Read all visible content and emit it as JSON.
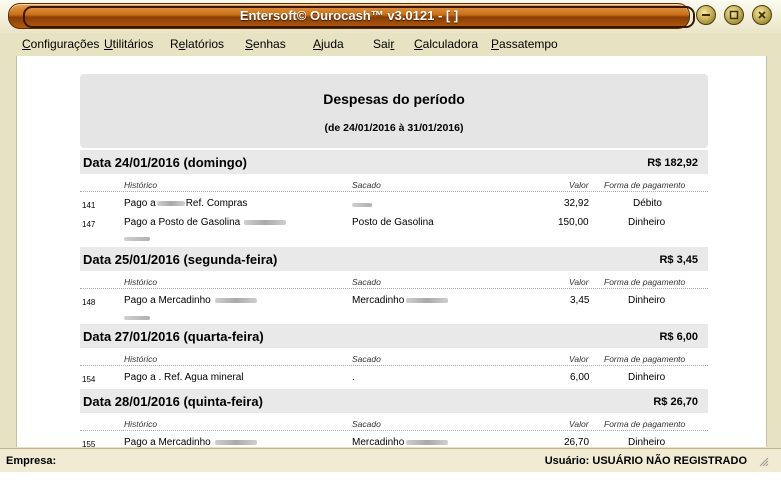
{
  "window": {
    "title": "Entersoft© Ourocash™ v3.0121 - [ ]"
  },
  "menu": [
    {
      "label": "Configurações",
      "underline_index": 0
    },
    {
      "label": "Utilitários",
      "underline_index": 0
    },
    {
      "label": "Relatórios",
      "underline_index": 1
    },
    {
      "label": "Senhas",
      "underline_index": 0
    },
    {
      "label": "Ajuda",
      "underline_index": 0
    },
    {
      "label": "Sair",
      "underline_index": 3
    },
    {
      "label": "Calculadora",
      "underline_index": 0
    },
    {
      "label": "Passatempo",
      "underline_index": 0
    }
  ],
  "report": {
    "title": "Despesas do período",
    "subtitle": "(de 24/01/2016 à 31/01/2016)",
    "col_historico": "Histórico",
    "col_sacado": "Sacado",
    "col_valor": "Valor",
    "col_forma": "Forma de pagamento",
    "days": [
      {
        "label": "Data 24/01/2016  (domingo)",
        "total": "R$ 182,92",
        "rows": [
          {
            "id": "141",
            "historico_prefix": "Pago a",
            "historico_suffix": "Ref. Compras",
            "sacado": "",
            "valor": "32,92",
            "forma": "Débito"
          },
          {
            "id": "147",
            "historico_prefix": "Pago a Posto de Gasolina",
            "historico_suffix": "",
            "sacado": "Posto de Gasolina",
            "valor": "150,00",
            "forma": "Dinheiro"
          }
        ]
      },
      {
        "label": "Data 25/01/2016  (segunda-feira)",
        "total": "R$ 3,45",
        "rows": [
          {
            "id": "148",
            "historico_prefix": "Pago a Mercadinho",
            "historico_suffix": "",
            "sacado": "Mercadinho",
            "valor": "3,45",
            "forma": "Dinheiro"
          }
        ]
      },
      {
        "label": "Data 27/01/2016  (quarta-feira)",
        "total": "R$ 6,00",
        "rows": [
          {
            "id": "154",
            "historico_prefix": "Pago a . Ref. Agua mineral",
            "historico_suffix": "",
            "sacado": ".",
            "valor": "6,00",
            "forma": "Dinheiro"
          }
        ]
      },
      {
        "label": "Data 28/01/2016  (quinta-feira)",
        "total": "R$ 26,70",
        "rows": [
          {
            "id": "155",
            "historico_prefix": "Pago a Mercadinho",
            "historico_suffix": "",
            "sacado": "Mercadinho",
            "valor": "26,70",
            "forma": "Dinheiro"
          }
        ]
      }
    ]
  },
  "status": {
    "empresa_label": "Empresa:",
    "usuario_text": "Usuário: USUÁRIO NÃO REGISTRADO"
  },
  "icons": {
    "minimize": "minimize-icon",
    "maximize": "maximize-icon",
    "close": "close-icon",
    "resize_grip": "resize-grip-icon"
  }
}
